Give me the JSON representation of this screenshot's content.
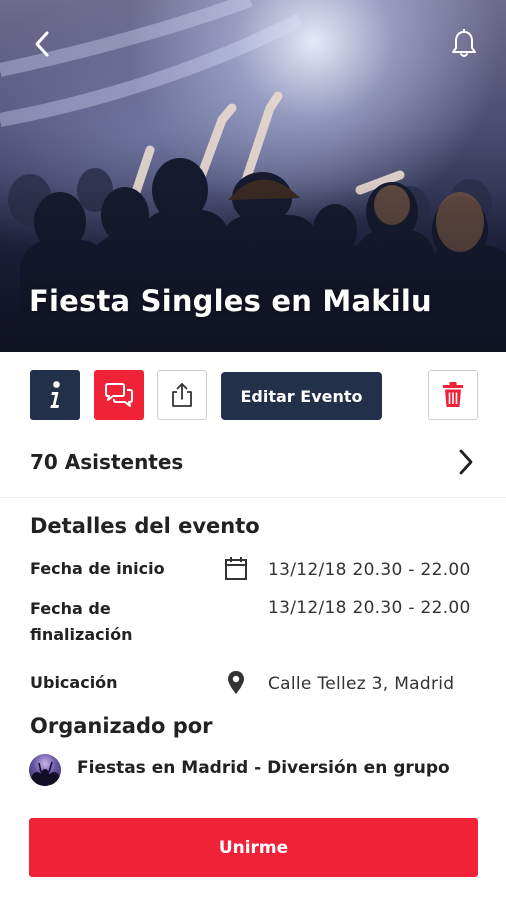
{
  "event": {
    "title": "Fiesta Singles en Makilu"
  },
  "header": {
    "back_icon": "chevron-left-icon",
    "notification_icon": "bell-icon"
  },
  "actions": {
    "info_icon": "info-icon",
    "chat_icon": "chat-bubbles-icon",
    "share_icon": "share-icon",
    "edit_label": "Editar Evento",
    "delete_icon": "trash-icon"
  },
  "attendees": {
    "label": "70 Asistentes"
  },
  "details": {
    "title": "Detalles del evento",
    "start_label": "Fecha de inicio",
    "start_value": "13/12/18 20.30 - 22.00",
    "end_label_line1": "Fecha de",
    "end_label_line2": "finalización",
    "end_value": "13/12/18 20.30 - 22.00",
    "location_label": "Ubicación",
    "location_value": "Calle Tellez 3,  Madrid"
  },
  "organizer": {
    "title": "Organizado por",
    "name": "Fiestas en Madrid - Diversión en grupo"
  },
  "join": {
    "label": "Unirme"
  },
  "colors": {
    "primary_red": "#f02238",
    "navy": "#23304a"
  }
}
